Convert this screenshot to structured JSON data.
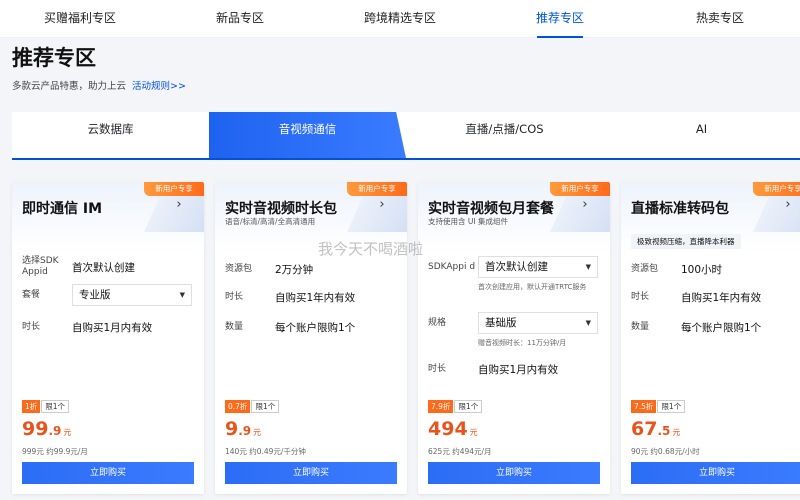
{
  "topnav": {
    "items": [
      "买赠福利专区",
      "新品专区",
      "跨境精选专区",
      "推荐专区",
      "热卖专区"
    ],
    "active_index": 3
  },
  "page": {
    "title": "推荐专区",
    "subtitle": "多款云产品特惠，助力上云",
    "rules_link": "活动规则>>"
  },
  "category_tabs": [
    "云数据库",
    "音视频通信",
    "直播/点播/COS",
    "AI"
  ],
  "category_active_index": 1,
  "watermark": "我今天不喝酒啦",
  "colors": {
    "accent": "#0052d9",
    "price": "#e8541e",
    "badge": "#ff6a1a"
  },
  "cards": [
    {
      "badge": "新用户专享",
      "title": "即时通信 IM",
      "desc": "",
      "tag": "",
      "rows": [
        {
          "k": "选择SDK Appid",
          "v": "首次默认创建"
        },
        {
          "k": "套餐",
          "v": "专业版",
          "select": true
        },
        {
          "k": "时长",
          "v": "自购买1月内有效"
        }
      ],
      "discount": "1折",
      "limit": "限1个",
      "price_int": "99",
      "price_dec": ".9",
      "unit": "元",
      "original": "999元  约99.9元/月",
      "buy": "立即购买"
    },
    {
      "badge": "新用户专享",
      "title": "实时音视频时长包",
      "desc": "语音/标清/高清/全高清通用",
      "tag": "",
      "rows": [
        {
          "k": "资源包",
          "v": "2万分钟"
        },
        {
          "k": "时长",
          "v": "自购买1年内有效"
        },
        {
          "k": "数量",
          "v": "每个账户限购1个"
        }
      ],
      "discount": "0.7折",
      "limit": "限1个",
      "price_int": "9",
      "price_dec": ".9",
      "unit": "元",
      "original": "140元  约0.49元/千分钟",
      "buy": "立即购买"
    },
    {
      "badge": "新用户专享",
      "title": "实时音视频包月套餐",
      "desc": "支持使用含 UI 集成组件",
      "tag": "",
      "rows": [
        {
          "k": "SDKAppi d",
          "v": "首次默认创建",
          "select": true
        },
        {
          "k": "规格",
          "v": "基础版",
          "select": true
        },
        {
          "k": "时长",
          "v": "自购买1月内有效"
        }
      ],
      "note1": "首次创建应用，默认开通TRTC服务",
      "note2": "赠音视频时长：11万分钟/月",
      "discount": "7.9折",
      "limit": "限1个",
      "price_int": "494",
      "price_dec": "",
      "unit": "元",
      "original": "625元  约494元/月",
      "buy": "立即购买"
    },
    {
      "badge": "新用户专享",
      "title": "直播标准转码包",
      "desc": "",
      "tag": "极致视频压缩，直播降本利器",
      "rows": [
        {
          "k": "资源包",
          "v": "100小时"
        },
        {
          "k": "时长",
          "v": "自购买1年内有效"
        },
        {
          "k": "数量",
          "v": "每个账户限购1个"
        }
      ],
      "discount": "7.5折",
      "limit": "限1个",
      "price_int": "67",
      "price_dec": ".5",
      "unit": "元",
      "original": "90元  约0.68元/小时",
      "buy": "立即购买"
    }
  ]
}
